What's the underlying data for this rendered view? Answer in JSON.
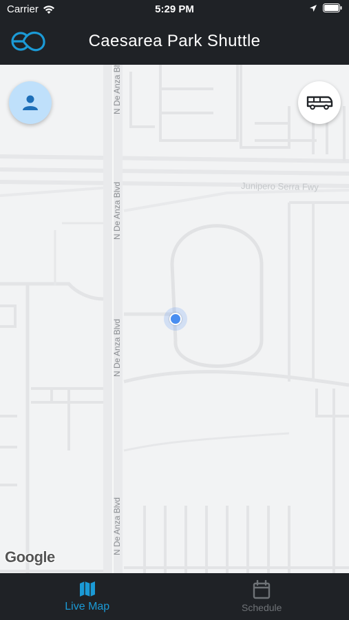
{
  "status_bar": {
    "carrier": "Carrier",
    "time": "5:29 PM",
    "icons": [
      "wifi-icon",
      "location-arrow-icon",
      "battery-icon"
    ]
  },
  "header": {
    "title": "Caesarea Park Shuttle",
    "logo_icon": "eo-logo-icon"
  },
  "map": {
    "road_labels": [
      "N De Anza Blvd",
      "N De Anza Blvd",
      "N De Anza Blvd",
      "N De Anza Blvd"
    ],
    "freeway_label": "Junipero Serra Fwy",
    "attribution": "Google",
    "profile_icon": "person-icon",
    "shuttle_icon": "bus-icon"
  },
  "tabs": [
    {
      "label": "Live Map",
      "icon": "map-icon",
      "active": true
    },
    {
      "label": "Schedule",
      "icon": "calendar-icon",
      "active": false
    }
  ],
  "colors": {
    "bar_background": "#1f2226",
    "accent": "#1b9ad6",
    "map_background": "#f2f3f4",
    "location_blue": "#4a8ef0"
  }
}
